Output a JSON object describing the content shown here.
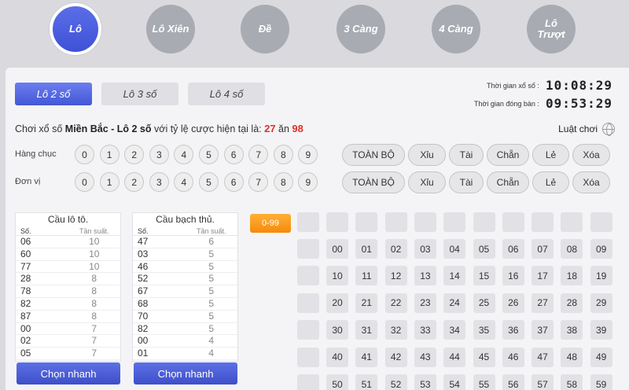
{
  "nav": [
    {
      "label": "Lô",
      "active": true
    },
    {
      "label": "Lô Xiên",
      "active": false
    },
    {
      "label": "Đề",
      "active": false
    },
    {
      "label": "3 Càng",
      "active": false
    },
    {
      "label": "4 Càng",
      "active": false
    },
    {
      "label": "Lô Trượt",
      "active": false
    }
  ],
  "tabs": [
    {
      "label": "Lô 2 số",
      "active": true
    },
    {
      "label": "Lô 3 số",
      "active": false
    },
    {
      "label": "Lô 4 số",
      "active": false
    }
  ],
  "timers": {
    "draw_label": "Thời gian xổ số :",
    "draw_value": "10:08:29",
    "close_label": "Thời gian đóng bàn :",
    "close_value": "09:53:29"
  },
  "description": {
    "prefix": "Chơi xổ số ",
    "bold": "Miền Bắc - Lô 2 số",
    "middle": " với tỷ lệ cược hiện tại là: ",
    "odds_a": "27",
    "odds_sep": " ăn ",
    "odds_b": "98"
  },
  "rules_label": "Luật chơi",
  "selectors": {
    "tens_label": "Hàng chục",
    "units_label": "Đơn vị",
    "digits": [
      "0",
      "1",
      "2",
      "3",
      "4",
      "5",
      "6",
      "7",
      "8",
      "9"
    ],
    "quick_filters": [
      "TOÀN BỘ",
      "Xỉu",
      "Tài",
      "Chẵn",
      "Lẻ",
      "Xóa"
    ]
  },
  "freq_tables": [
    {
      "title": "Cầu lô tô.",
      "col_num": "Số.",
      "col_freq": "Tần suất.",
      "rows": [
        [
          "06",
          "10"
        ],
        [
          "60",
          "10"
        ],
        [
          "77",
          "10"
        ],
        [
          "28",
          "8"
        ],
        [
          "78",
          "8"
        ],
        [
          "82",
          "8"
        ],
        [
          "87",
          "8"
        ],
        [
          "00",
          "7"
        ],
        [
          "02",
          "7"
        ],
        [
          "05",
          "7"
        ]
      ],
      "button": "Chọn nhanh"
    },
    {
      "title": "Cầu bạch thủ.",
      "col_num": "Số.",
      "col_freq": "Tần suất.",
      "rows": [
        [
          "47",
          "6"
        ],
        [
          "03",
          "5"
        ],
        [
          "46",
          "5"
        ],
        [
          "52",
          "5"
        ],
        [
          "67",
          "5"
        ],
        [
          "68",
          "5"
        ],
        [
          "70",
          "5"
        ],
        [
          "82",
          "5"
        ],
        [
          "00",
          "4"
        ],
        [
          "01",
          "4"
        ]
      ],
      "button": "Chọn nhanh"
    }
  ],
  "range_button": "0-99",
  "number_grid": [
    [
      "00",
      "01",
      "02",
      "03",
      "04",
      "05",
      "06",
      "07",
      "08",
      "09"
    ],
    [
      "10",
      "11",
      "12",
      "13",
      "14",
      "15",
      "16",
      "17",
      "18",
      "19"
    ],
    [
      "20",
      "21",
      "22",
      "23",
      "24",
      "25",
      "26",
      "27",
      "28",
      "29"
    ],
    [
      "30",
      "31",
      "32",
      "33",
      "34",
      "35",
      "36",
      "37",
      "38",
      "39"
    ],
    [
      "40",
      "41",
      "42",
      "43",
      "44",
      "45",
      "46",
      "47",
      "48",
      "49"
    ],
    [
      "50",
      "51",
      "52",
      "53",
      "54",
      "55",
      "56",
      "57",
      "58",
      "59"
    ]
  ]
}
